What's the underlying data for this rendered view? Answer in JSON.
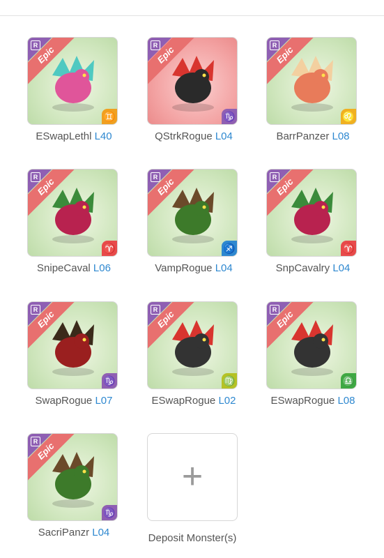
{
  "rarity_label": "Epic",
  "r_badge": "R",
  "monsters": [
    {
      "name": "ESwapLethl",
      "level": "L40",
      "bg": "green",
      "sign": "♊",
      "sign_color": "#f0a020",
      "sign_icon": "gemini-sign-icon",
      "body": "#e0559a",
      "accent": "#4fc9c1"
    },
    {
      "name": "QStrkRogue",
      "level": "L04",
      "bg": "red",
      "sign": "♑",
      "sign_color": "#8f5fb3",
      "sign_icon": "capricorn-sign-icon",
      "body": "#2a2a2a",
      "accent": "#d8352f"
    },
    {
      "name": "BarrPanzer",
      "level": "L08",
      "bg": "green",
      "sign": "♌",
      "sign_color": "#f0b020",
      "sign_icon": "leo-sign-icon",
      "body": "#e87b5a",
      "accent": "#f3d0a0"
    },
    {
      "name": "SnipeCaval",
      "level": "L06",
      "bg": "green",
      "sign": "♈",
      "sign_color": "#e84a4a",
      "sign_icon": "aries-sign-icon",
      "body": "#b8224f",
      "accent": "#3b8b3b"
    },
    {
      "name": "VampRogue",
      "level": "L04",
      "bg": "green",
      "sign": "♐",
      "sign_color": "#2e88d0",
      "sign_icon": "sagittarius-sign-icon",
      "body": "#3d7a2a",
      "accent": "#6b4a2a"
    },
    {
      "name": "SnpCavalry",
      "level": "L04",
      "bg": "green",
      "sign": "♈",
      "sign_color": "#e84a4a",
      "sign_icon": "aries-sign-icon",
      "body": "#b8224f",
      "accent": "#3b8b3b"
    },
    {
      "name": "SwapRogue",
      "level": "L07",
      "bg": "green",
      "sign": "♑",
      "sign_color": "#8f5fb3",
      "sign_icon": "capricorn-sign-icon",
      "body": "#9a1f1f",
      "accent": "#3a2a1a"
    },
    {
      "name": "ESwapRogue",
      "level": "L02",
      "bg": "green",
      "sign": "♍",
      "sign_color": "#b5c225",
      "sign_icon": "virgo-sign-icon",
      "body": "#333333",
      "accent": "#d8352f"
    },
    {
      "name": "ESwapRogue",
      "level": "L08",
      "bg": "green",
      "sign": "♎",
      "sign_color": "#3ea843",
      "sign_icon": "libra-sign-icon",
      "body": "#333333",
      "accent": "#d8352f"
    },
    {
      "name": "SacriPanzr",
      "level": "L04",
      "bg": "green",
      "sign": "♑",
      "sign_color": "#8f5fb3",
      "sign_icon": "capricorn-sign-icon",
      "body": "#3d7a2a",
      "accent": "#6b4a2a"
    }
  ],
  "deposit": {
    "label": "Deposit Monster(s)",
    "icon": "plus-icon"
  }
}
